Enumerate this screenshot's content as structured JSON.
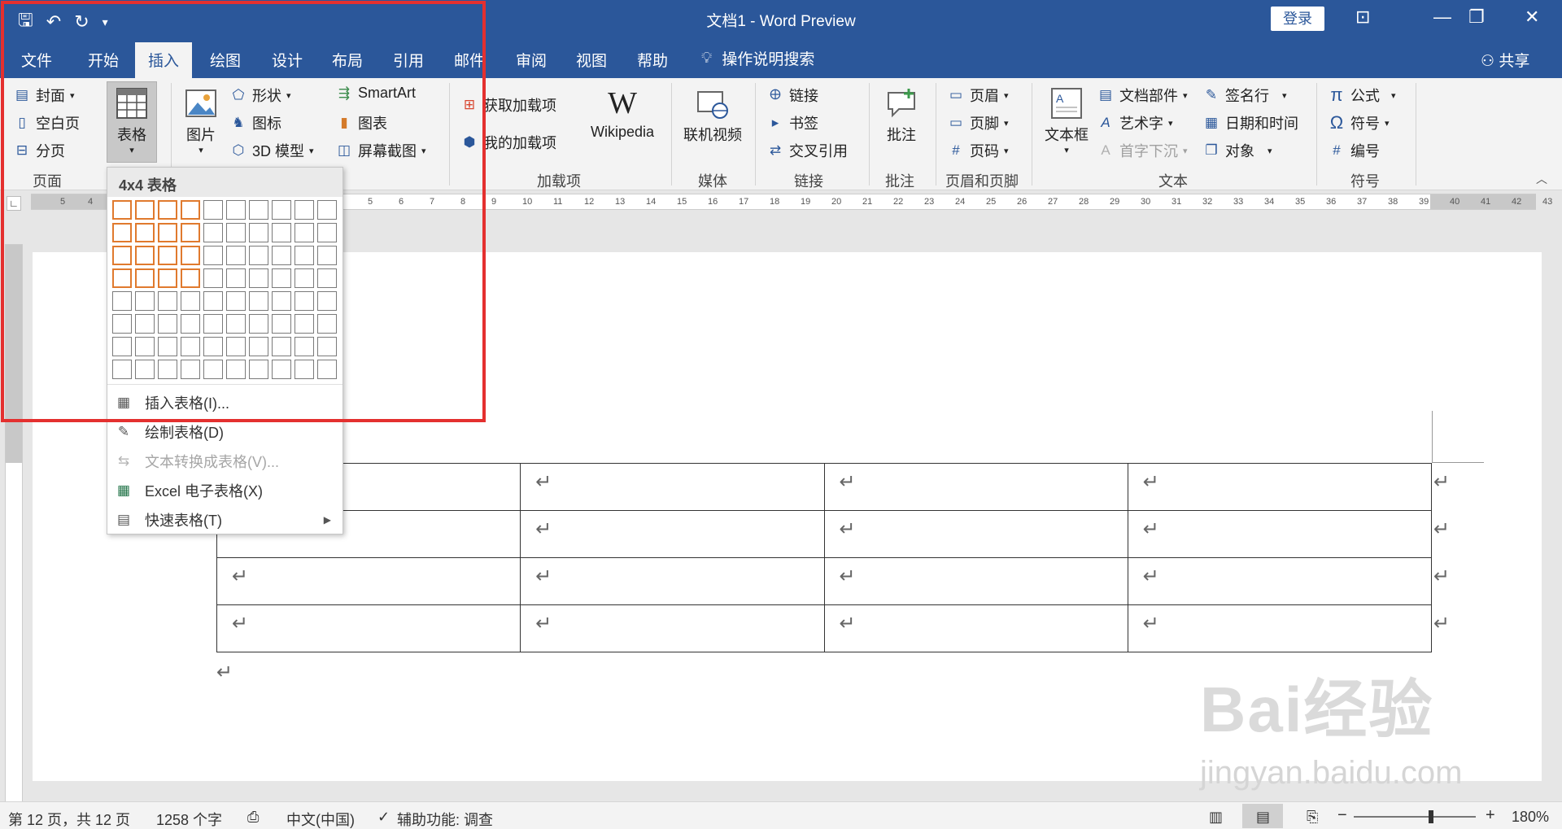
{
  "window": {
    "title": "文档1  -  Word Preview",
    "login_label": "登录",
    "share_label": "共享",
    "search_label": "操作说明搜索"
  },
  "tabs": [
    "文件",
    "开始",
    "插入",
    "绘图",
    "设计",
    "布局",
    "引用",
    "邮件",
    "审阅",
    "视图",
    "帮助"
  ],
  "ribbon": {
    "pages": {
      "cover": "封面",
      "blank_page": "空白页",
      "page_break": "分页",
      "group": "页面"
    },
    "table": {
      "label": "表格"
    },
    "illustrations": {
      "picture": "图片",
      "shapes": "形状",
      "icons": "图标",
      "model3d": "3D 模型",
      "smartart": "SmartArt",
      "chart": "图表",
      "screenshot": "屏幕截图"
    },
    "addins": {
      "get_addins": "获取加载项",
      "my_addins": "我的加载项",
      "wikipedia": "Wikipedia",
      "group": "加载项"
    },
    "media": {
      "online_video": "联机视频",
      "group": "媒体"
    },
    "links": {
      "link": "链接",
      "bookmark": "书签",
      "cross_ref": "交叉引用",
      "group": "链接"
    },
    "comments": {
      "comment": "批注",
      "group": "批注"
    },
    "header_footer": {
      "header": "页眉",
      "footer": "页脚",
      "page_number": "页码",
      "group": "页眉和页脚"
    },
    "text": {
      "textbox": "文本框",
      "quick_parts": "文档部件",
      "wordart": "艺术字",
      "dropcap": "首字下沉",
      "signature": "签名行",
      "datetime": "日期和时间",
      "object": "对象",
      "group": "文本"
    },
    "symbols": {
      "equation": "公式",
      "symbol": "符号",
      "numbering": "编号",
      "group": "符号"
    }
  },
  "dropdown": {
    "header": "4x4 表格",
    "grid_rows": 8,
    "grid_cols": 10,
    "selected_rows": 4,
    "selected_cols": 4,
    "items": [
      {
        "label": "插入表格(I)...",
        "icon": "table-icon",
        "disabled": false
      },
      {
        "label": "绘制表格(D)",
        "icon": "pencil-table-icon",
        "disabled": false
      },
      {
        "label": "文本转换成表格(V)...",
        "icon": "convert-text-icon",
        "disabled": true
      },
      {
        "label": "Excel 电子表格(X)",
        "icon": "excel-icon",
        "disabled": false
      },
      {
        "label": "快速表格(T)",
        "icon": "quick-table-icon",
        "disabled": false
      }
    ]
  },
  "ruler": {
    "left_numbers": [
      "5",
      "4"
    ],
    "numbers": [
      "5",
      "6",
      "7",
      "8",
      "9",
      "10",
      "11",
      "12",
      "13",
      "14",
      "15",
      "16",
      "17",
      "18",
      "19",
      "20",
      "21",
      "22",
      "23",
      "24",
      "25",
      "26",
      "27",
      "28",
      "29",
      "30",
      "31",
      "32",
      "33",
      "34",
      "35",
      "36",
      "37",
      "38",
      "39",
      "40",
      "41",
      "42",
      "43"
    ]
  },
  "document": {
    "para_mark": "↵",
    "table_rows": 4,
    "table_cols": 4
  },
  "statusbar": {
    "page_info": "第 12 页，共 12 页",
    "word_count": "1258 个字",
    "language": "中文(中国)",
    "accessibility": "辅助功能: 调查",
    "zoom": "180%"
  },
  "watermark": {
    "brand": "Bai经验",
    "url": "jingyan.baidu.com"
  },
  "colors": {
    "accent": "#2b579a",
    "highlight": "#e4302f",
    "grid_selected": "#e07a2e"
  }
}
